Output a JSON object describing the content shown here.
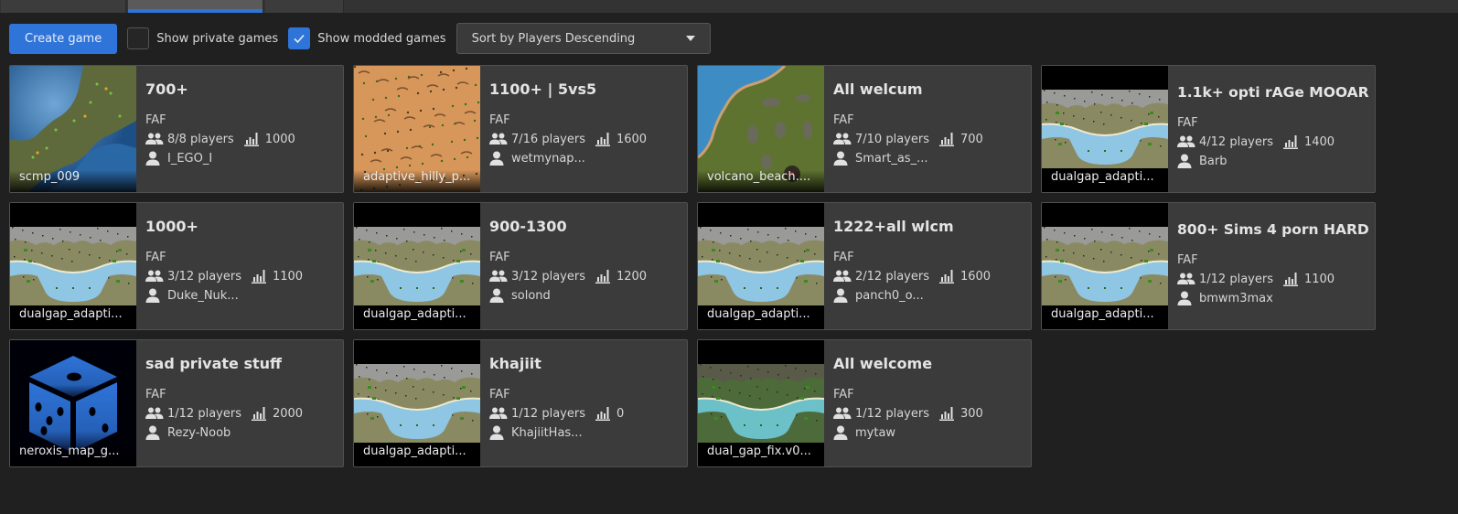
{
  "tabs": [
    {
      "label": "",
      "active": false
    },
    {
      "label": "",
      "active": true
    },
    {
      "label": "",
      "active": false
    }
  ],
  "toolbar": {
    "create_label": "Create game",
    "show_private_label": "Show private games",
    "show_private_checked": false,
    "show_modded_label": "Show modded games",
    "show_modded_checked": true,
    "sort_selected": "Sort by Players Descending"
  },
  "colors": {
    "accent": "#2f74d9",
    "background": "#202020",
    "card": "#3b3b3b"
  },
  "games": [
    {
      "title": "700+",
      "mod": "FAF",
      "players": "8/8 players",
      "rating": "1000",
      "host": "I_EGO_I",
      "map": "scmp_009",
      "thumb": "sea"
    },
    {
      "title": "1100+ | 5vs5",
      "mod": "FAF",
      "players": "7/16 players",
      "rating": "1600",
      "host": "wetmynap...",
      "map": "adaptive_hilly_p...",
      "thumb": "desert"
    },
    {
      "title": "All welcum",
      "mod": "FAF",
      "players": "7/10 players",
      "rating": "700",
      "host": "Smart_as_...",
      "map": "volcano_beach....",
      "thumb": "volcano"
    },
    {
      "title": "1.1k+ opti rAGe MOOAR",
      "mod": "FAF",
      "players": "4/12 players",
      "rating": "1400",
      "host": "Barb",
      "map": "dualgap_adapti...",
      "thumb": "dualgap"
    },
    {
      "title": "1000+",
      "mod": "FAF",
      "players": "3/12 players",
      "rating": "1100",
      "host": "Duke_Nuk...",
      "map": "dualgap_adapti...",
      "thumb": "dualgap"
    },
    {
      "title": "900-1300",
      "mod": "FAF",
      "players": "3/12 players",
      "rating": "1200",
      "host": "solond",
      "map": "dualgap_adapti...",
      "thumb": "dualgap"
    },
    {
      "title": "1222+all wlcm",
      "mod": "FAF",
      "players": "2/12 players",
      "rating": "1600",
      "host": "panch0_o...",
      "map": "dualgap_adapti...",
      "thumb": "dualgap"
    },
    {
      "title": "800+ Sims 4 porn HARD",
      "mod": "FAF",
      "players": "1/12 players",
      "rating": "1100",
      "host": "bmwm3max",
      "map": "dualgap_adapti...",
      "thumb": "dualgap"
    },
    {
      "title": "sad private stuff",
      "mod": "FAF",
      "players": "1/12 players",
      "rating": "2000",
      "host": "Rezy-Noob",
      "map": "neroxis_map_g...",
      "thumb": "dice"
    },
    {
      "title": "khajiit",
      "mod": "FAF",
      "players": "1/12 players",
      "rating": "0",
      "host": "KhajiitHas...",
      "map": "dualgap_adapti...",
      "thumb": "dualgap"
    },
    {
      "title": "All welcome",
      "mod": "FAF",
      "players": "1/12 players",
      "rating": "300",
      "host": "mytaw",
      "map": "dual_gap_fix.v0...",
      "thumb": "dualgapfix"
    }
  ]
}
